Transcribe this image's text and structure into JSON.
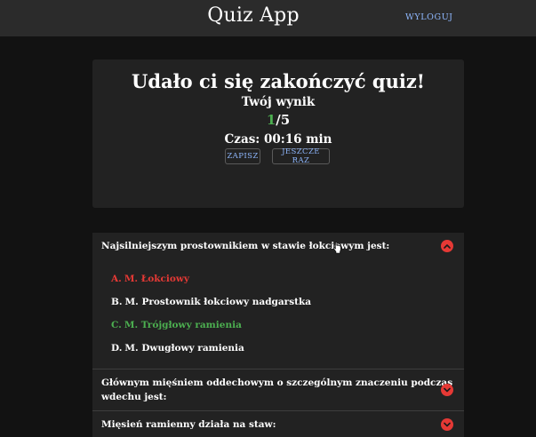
{
  "header": {
    "title": "Quiz App",
    "logout_label": "WYLOGUJ"
  },
  "result": {
    "title": "Udało ci się zakończyć quiz!",
    "subtitle": "Twój wynik",
    "score_correct": "1",
    "score_total": "/5",
    "time": "Czas: 00:16 min",
    "save_label": "ZAPISZ",
    "again_label": "JESZCZE RAZ"
  },
  "questions": [
    {
      "text": "Najsilniejszym prostownikiem w stawie łokciowym jest:",
      "expanded": true,
      "answers": [
        {
          "letter": "A.",
          "text": "M. Łokciowy",
          "status": "wrong"
        },
        {
          "letter": "B.",
          "text": "M. Prostownik łokciowy nadgarstka",
          "status": "neutral"
        },
        {
          "letter": "C.",
          "text": "M. Trójgłowy ramienia",
          "status": "correct"
        },
        {
          "letter": "D.",
          "text": "M. Dwugłowy ramienia",
          "status": "neutral"
        }
      ]
    },
    {
      "text_line1": "Głównym mięśniem oddechowym o szczególnym znaczeniu podczas",
      "text_line2": "wdechu jest:",
      "expanded": false
    },
    {
      "text": "Mięsień ramienny działa na staw:",
      "expanded": false
    }
  ],
  "colors": {
    "background": "#121212",
    "header": "#2b2b2b",
    "card": "#222222",
    "link": "#8fb8ff",
    "correct": "#4caf50",
    "wrong": "#e53935"
  },
  "icons": {
    "collapse": "chevron-up-icon",
    "expand": "chevron-down-icon"
  }
}
